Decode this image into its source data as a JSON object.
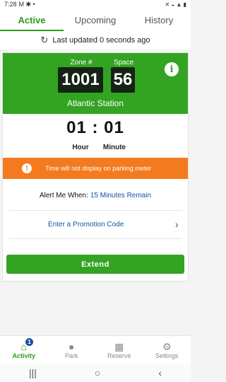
{
  "status_bar": {
    "time": "7:28",
    "left_icons": "M ✱ •",
    "right_icons": "✕ ◒ ▲ ▮"
  },
  "tabs": [
    {
      "label": "Active"
    },
    {
      "label": "Upcoming"
    },
    {
      "label": "History"
    }
  ],
  "updated_text": "Last updated 0 seconds ago",
  "session": {
    "zone_label": "Zone #",
    "zone": "1001",
    "space_label": "Space",
    "space": "56",
    "location": "Atlantic Station",
    "time_remaining": "01 : 01",
    "hour_label": "Hour",
    "minute_label": "Minute",
    "warning": "Time will not display on parking meter",
    "alert_label": "Alert Me When:",
    "alert_value": "15 Minutes Remain",
    "promo_label": "Enter a Promotion Code",
    "extend_label": "Extend"
  },
  "nav": [
    {
      "label": "Activity",
      "icon": "home-icon",
      "badge": "1"
    },
    {
      "label": "Park",
      "icon": "park-icon"
    },
    {
      "label": "Reserve",
      "icon": "calendar-icon"
    },
    {
      "label": "Settings",
      "icon": "gear-icon"
    }
  ],
  "colors": {
    "brand_green": "#33a322",
    "warning_orange": "#f47a1f",
    "link_blue": "#1a4fa8"
  }
}
